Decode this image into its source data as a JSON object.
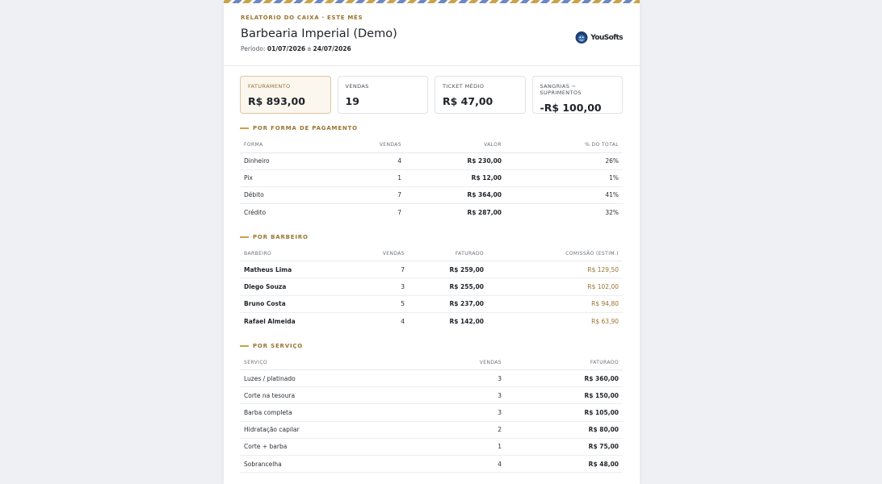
{
  "header": {
    "kicker": "RELATÓRIO DO CAIXA · ESTE MÊS",
    "title": "Barbearia Imperial (Demo)",
    "period_label": "Período:",
    "period_start": "01/07/2026",
    "period_sep": "a",
    "period_end": "24/07/2026",
    "logo_text": "YouSofts"
  },
  "cards": [
    {
      "label": "FATURAMENTO",
      "value": "R$ 893,00"
    },
    {
      "label": "VENDAS",
      "value": "19"
    },
    {
      "label": "TICKET MÉDIO",
      "value": "R$ 47,00"
    },
    {
      "label": "SANGRIAS − SUPRIMENTOS",
      "value": "-R$ 100,00"
    }
  ],
  "payment": {
    "title": "POR FORMA DE PAGAMENTO",
    "columns": [
      "FORMA",
      "VENDAS",
      "VALOR",
      "% DO TOTAL"
    ],
    "rows": [
      [
        "Dinheiro",
        "4",
        "R$ 230,00",
        "26%"
      ],
      [
        "Pix",
        "1",
        "R$ 12,00",
        "1%"
      ],
      [
        "Débito",
        "7",
        "R$ 364,00",
        "41%"
      ],
      [
        "Crédito",
        "7",
        "R$ 287,00",
        "32%"
      ]
    ]
  },
  "barber": {
    "title": "POR BARBEIRO",
    "columns": [
      "BARBEIRO",
      "VENDAS",
      "FATURADO",
      "COMISSÃO (ESTIM.)"
    ],
    "rows": [
      [
        "Matheus Lima",
        "7",
        "R$ 259,00",
        "R$ 129,50"
      ],
      [
        "Diego Souza",
        "3",
        "R$ 255,00",
        "R$ 102,00"
      ],
      [
        "Bruno Costa",
        "5",
        "R$ 237,00",
        "R$ 94,80"
      ],
      [
        "Rafael Almeida",
        "4",
        "R$ 142,00",
        "R$ 63,90"
      ]
    ]
  },
  "service": {
    "title": "POR SERVIÇO",
    "columns": [
      "SERVIÇO",
      "VENDAS",
      "FATURADO"
    ],
    "rows": [
      [
        "Luzes / platinado",
        "3",
        "R$ 360,00"
      ],
      [
        "Corte na tesoura",
        "3",
        "R$ 150,00"
      ],
      [
        "Barba completa",
        "3",
        "R$ 105,00"
      ],
      [
        "Hidratação capilar",
        "2",
        "R$ 80,00"
      ],
      [
        "Corte + barba",
        "1",
        "R$ 75,00"
      ],
      [
        "Sobrancelha",
        "4",
        "R$ 48,00"
      ]
    ]
  }
}
